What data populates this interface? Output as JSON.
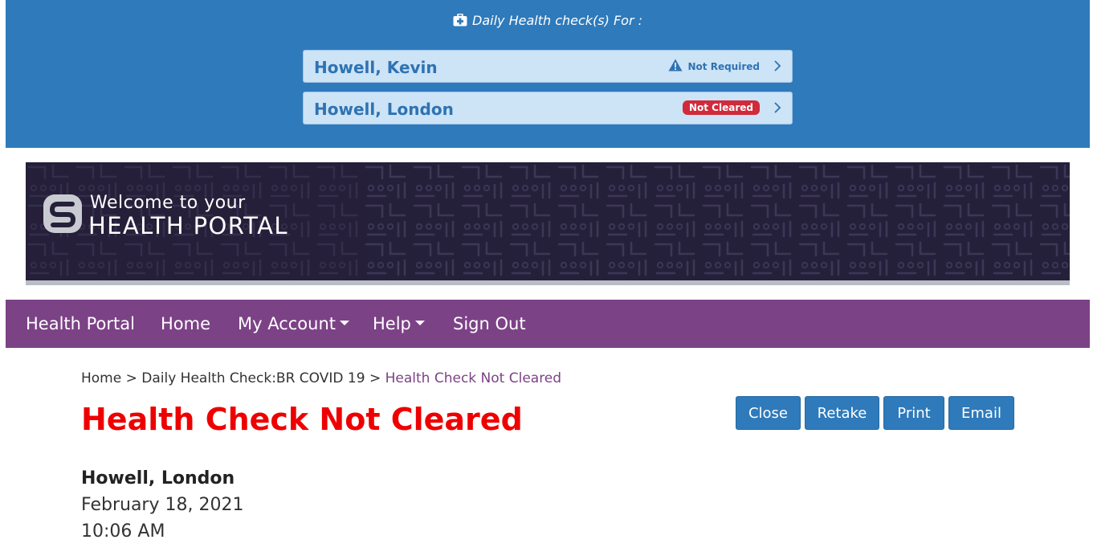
{
  "daily_checks": {
    "header": "Daily Health check(s) For :",
    "people": [
      {
        "name": "Howell, Kevin",
        "status": "Not Required",
        "status_kind": "warning"
      },
      {
        "name": "Howell, London",
        "status": "Not Cleared",
        "status_kind": "danger"
      }
    ]
  },
  "hero": {
    "welcome": "Welcome to your",
    "title": "HEALTH PORTAL"
  },
  "nav": {
    "items": [
      {
        "label": "Health Portal"
      },
      {
        "label": "Home"
      },
      {
        "label": "My Account"
      },
      {
        "label": "Help"
      },
      {
        "label": "Sign Out"
      }
    ]
  },
  "breadcrumb": {
    "home": "Home",
    "sep1": ">",
    "check": "Daily Health Check:BR COVID 19",
    "sep2": ">",
    "current": "Health Check Not Cleared"
  },
  "page": {
    "title": "Health Check Not Cleared",
    "buttons": {
      "close": "Close",
      "retake": "Retake",
      "print": "Print",
      "email": "Email"
    },
    "person_name": "Howell, London",
    "date": "February 18, 2021",
    "time": "10:06 AM"
  },
  "colors": {
    "banner_blue": "#2e7abb",
    "card_blue": "#cde3f6",
    "nav_purple": "#7c4286",
    "title_red": "#ee0000",
    "badge_red": "#d12a3b"
  }
}
